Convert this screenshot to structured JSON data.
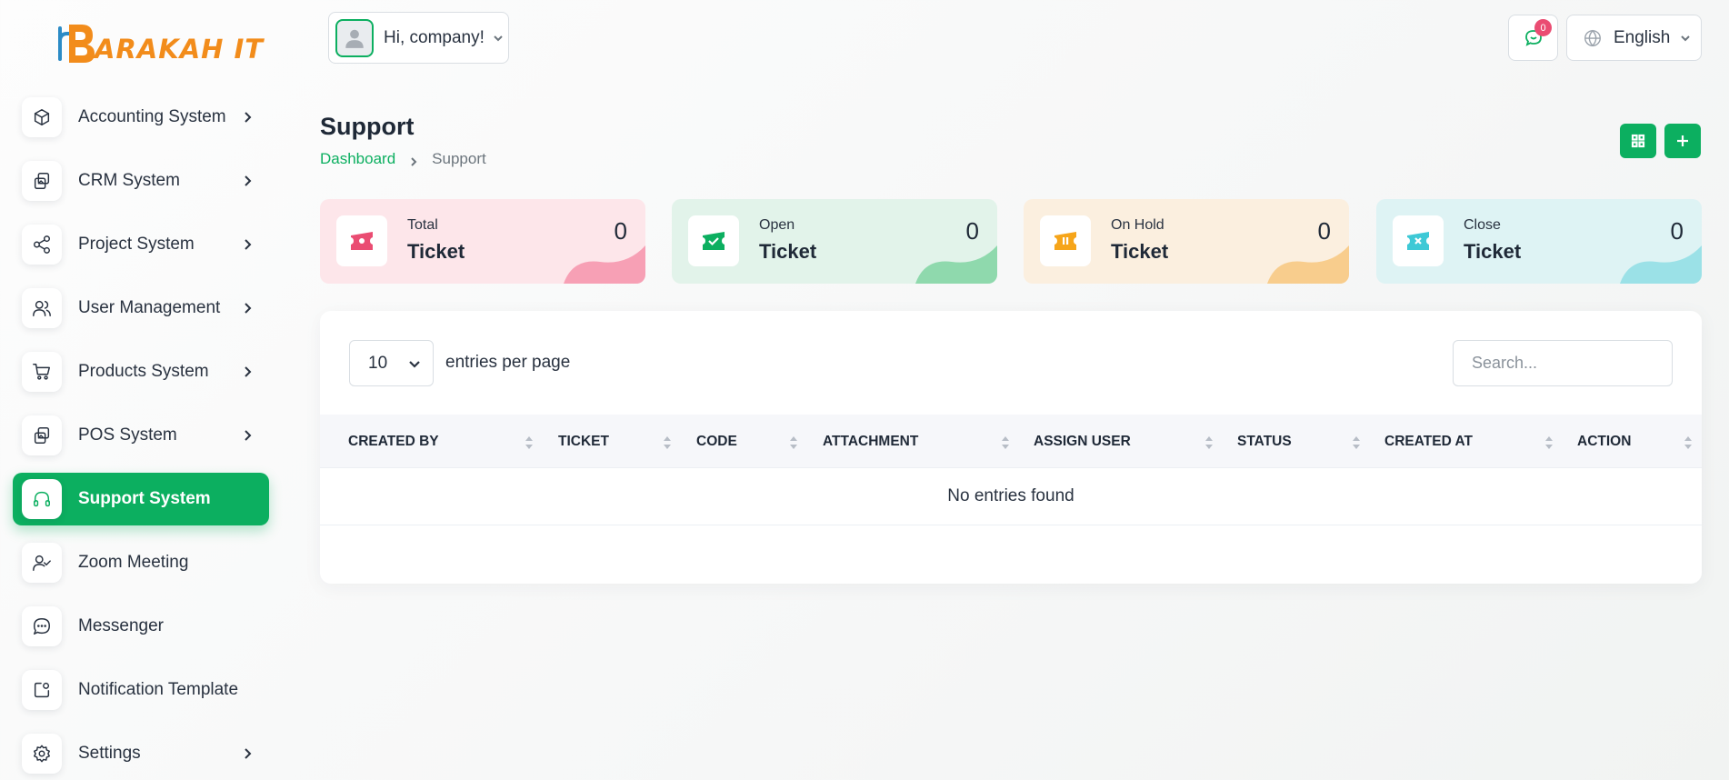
{
  "brand": {
    "logo_part1": "B",
    "logo_part2": "ARAKAH IT",
    "color_orange": "#f28c1b",
    "color_blue": "#2b8bc6"
  },
  "theme": {
    "accent": "#0caf60",
    "badge": "#ea4c72"
  },
  "sidebar": {
    "items": [
      {
        "label": "Accounting System",
        "icon": "box-icon",
        "has_children": true
      },
      {
        "label": "CRM System",
        "icon": "layers-icon",
        "has_children": true
      },
      {
        "label": "Project System",
        "icon": "share-icon",
        "has_children": true
      },
      {
        "label": "User Management",
        "icon": "users-icon",
        "has_children": true
      },
      {
        "label": "Products System",
        "icon": "cart-icon",
        "has_children": true
      },
      {
        "label": "POS System",
        "icon": "layers-icon",
        "has_children": true
      },
      {
        "label": "Support System",
        "icon": "headphones-icon",
        "has_children": false,
        "active": true
      },
      {
        "label": "Zoom Meeting",
        "icon": "user-check-icon",
        "has_children": false
      },
      {
        "label": "Messenger",
        "icon": "message-icon",
        "has_children": false
      },
      {
        "label": "Notification Template",
        "icon": "notification-icon",
        "has_children": false
      },
      {
        "label": "Settings",
        "icon": "gear-icon",
        "has_children": true
      }
    ]
  },
  "header": {
    "greeting": "Hi, company!",
    "notification_count": "0",
    "language": "English"
  },
  "page": {
    "title": "Support",
    "breadcrumb": [
      "Dashboard",
      "Support"
    ]
  },
  "stats": [
    {
      "sub": "Total",
      "main": "Ticket",
      "count": "0",
      "bg": "#fde6ea",
      "accent": "#ea4c72",
      "wave": "#f7a0b5"
    },
    {
      "sub": "Open",
      "main": "Ticket",
      "count": "0",
      "bg": "#e2f3ea",
      "accent": "#0caf60",
      "wave": "#8fd9ad"
    },
    {
      "sub": "On Hold",
      "main": "Ticket",
      "count": "0",
      "bg": "#fbefdf",
      "accent": "#f6a51a",
      "wave": "#f8cd8d"
    },
    {
      "sub": "Close",
      "main": "Ticket",
      "count": "0",
      "bg": "#def3f4",
      "accent": "#3ec9d6",
      "wave": "#9be1e7"
    }
  ],
  "table": {
    "per_page_value": "10",
    "per_page_label": "entries per page",
    "search_placeholder": "Search...",
    "columns": [
      "CREATED BY",
      "TICKET",
      "CODE",
      "ATTACHMENT",
      "ASSIGN USER",
      "STATUS",
      "CREATED AT",
      "ACTION"
    ],
    "empty_text": "No entries found"
  }
}
